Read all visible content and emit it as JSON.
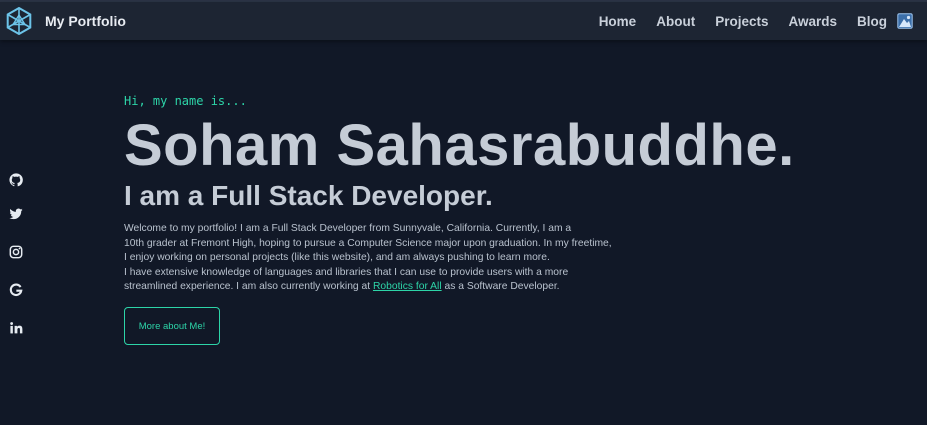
{
  "navbar": {
    "brand": "My Portfolio",
    "links": [
      "Home",
      "About",
      "Projects",
      "Awards",
      "Blog"
    ]
  },
  "social_icons": [
    "github-icon",
    "twitter-icon",
    "instagram-icon",
    "google-icon",
    "linkedin-icon"
  ],
  "hero": {
    "greeting": "Hi, my name is...",
    "name": "Soham Sahasrabuddhe.",
    "tagline": "I am a Full Stack Developer.",
    "bio_lines": [
      "Welcome to my portfolio! I am a Full Stack Developer from Sunnyvale, California. Currently, I am a",
      "10th grader at Fremont High, hoping to pursue a Computer Science major upon graduation. In my freetime,",
      "I enjoy working on personal projects (like this website), and am always pushing to learn more.",
      "I have extensive knowledge of languages and libraries that I can use to provide users with a more"
    ],
    "bio_last_prefix": "streamlined experience. I am also currently working at ",
    "bio_link_text": "Robotics for All",
    "bio_last_suffix": " as a Software Developer.",
    "cta_label": "More about Me!"
  },
  "colors": {
    "background": "#111827",
    "navbar": "#1d2533",
    "accent": "#2dd4a8",
    "text": "#c5ccd6"
  }
}
